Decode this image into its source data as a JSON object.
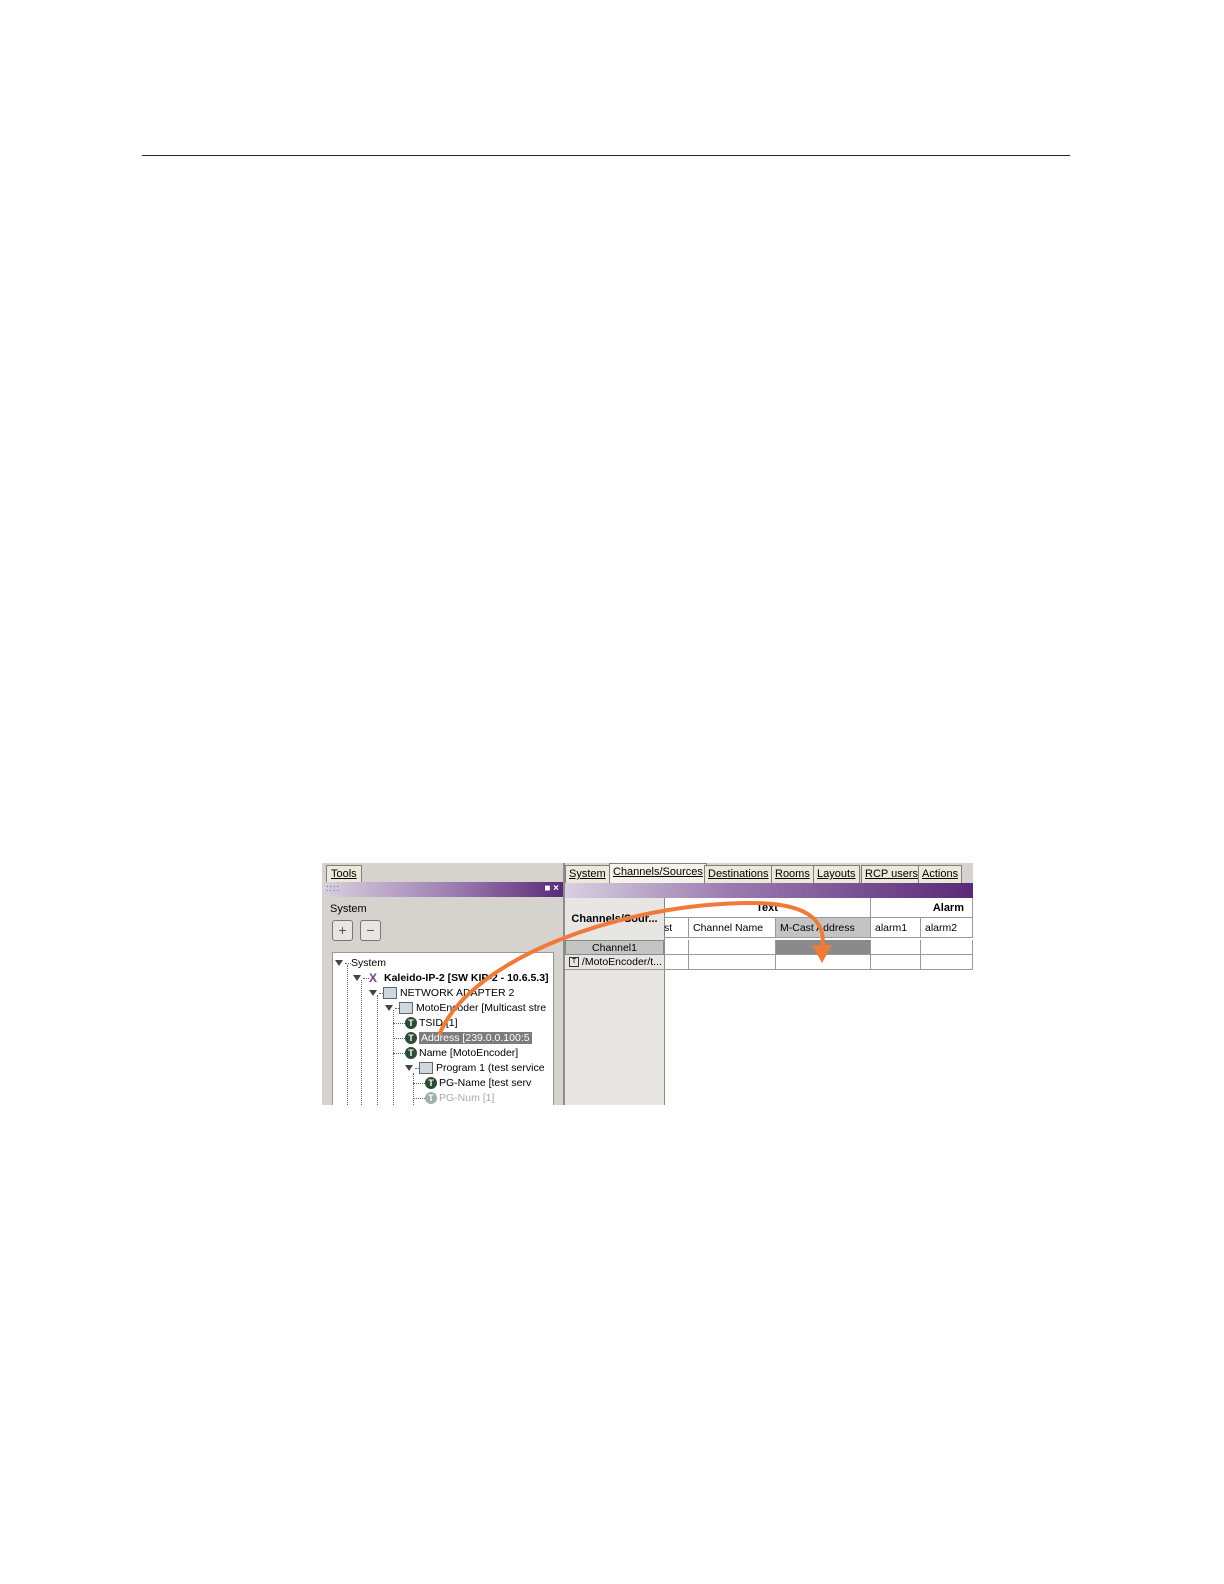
{
  "left_panel": {
    "tab": "Tools",
    "section_label": "System",
    "expand_symbol": "+",
    "collapse_symbol": "−",
    "window_buttons": "■ ×",
    "tree": [
      {
        "label": "System"
      },
      {
        "label": "Kaleido-IP-2 [SW KIP-2 - 10.6.5.3]",
        "bold": true
      },
      {
        "label": "NETWORK ADAPTER 2"
      },
      {
        "label": "MotoEncoder [Multicast stre"
      },
      {
        "label": "TSID [1]",
        "icon": "T"
      },
      {
        "label": "Address [239.0.0.100:5",
        "icon": "T",
        "selected": true
      },
      {
        "label": "Name [MotoEncoder]",
        "icon": "T"
      },
      {
        "label": "Program 1 (test service"
      },
      {
        "label": "PG-Name [test serv",
        "icon": "T"
      },
      {
        "label": "PG-Num [1]",
        "icon": "T",
        "faded": true
      }
    ]
  },
  "right_panel": {
    "tabs": [
      "System",
      "Channels/Sources",
      "Destinations",
      "Rooms",
      "Layouts",
      "RCP users",
      "Actions"
    ],
    "active_tab": "Channels/Sources",
    "grid": {
      "corner_header": "Channels/Sour...",
      "groups": [
        "Text",
        "Alarm"
      ],
      "columns": [
        "st",
        "Channel Name",
        "M-Cast Address",
        "alarm1",
        "alarm2"
      ],
      "rows": [
        "Channel1",
        "/MotoEncoder/t..."
      ]
    }
  },
  "colors": {
    "arrow": "#f07a3a",
    "title_bar_purple": "#5a2a78",
    "selection_gray": "#7c7c7c"
  }
}
